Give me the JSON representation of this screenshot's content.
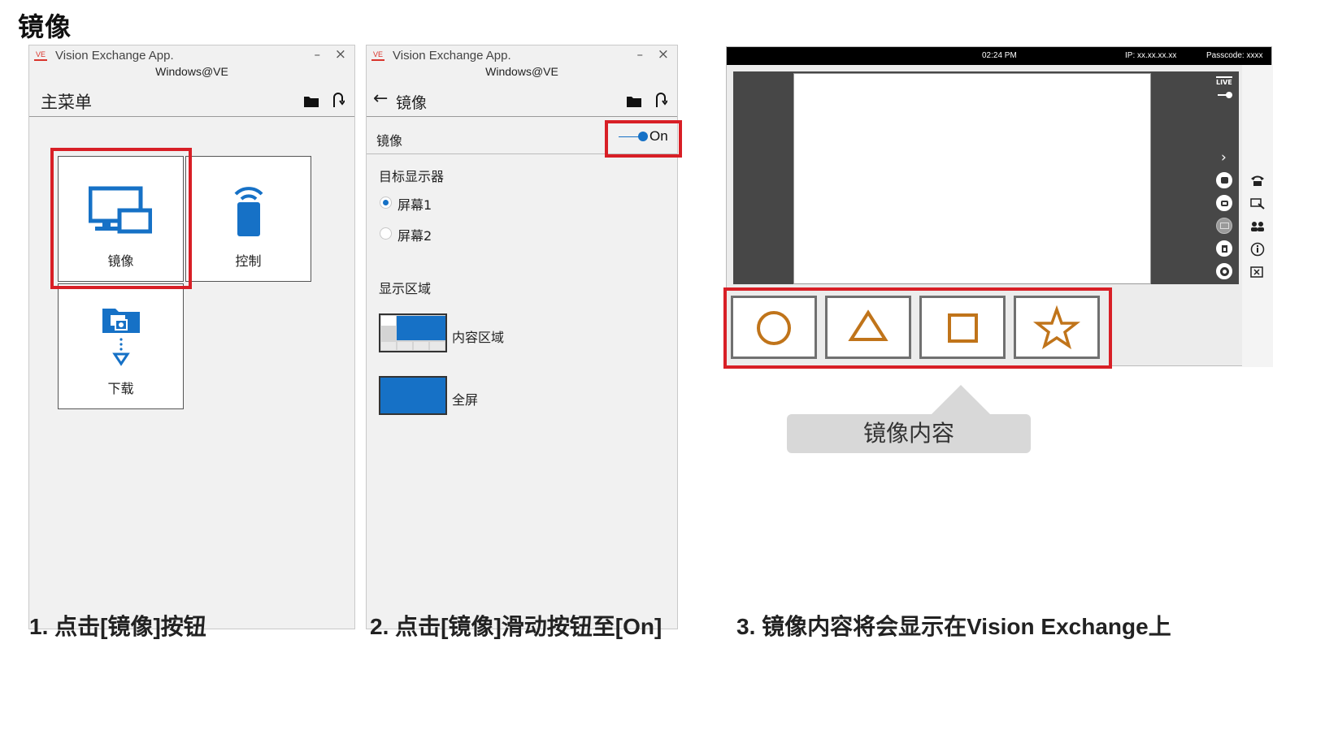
{
  "page": {
    "title": "镜像"
  },
  "window_common": {
    "app_title": "Vision Exchange App.",
    "subtitle": "Windows@VE",
    "logo_text": "VE",
    "minimize_glyph": "–",
    "close_glyph": "×"
  },
  "window1": {
    "header_title": "主菜单",
    "tiles": [
      {
        "label": "镜像",
        "icon": "mirror-monitor-icon"
      },
      {
        "label": "控制",
        "icon": "remote-control-icon"
      },
      {
        "label": "下载",
        "icon": "download-folder-icon"
      }
    ]
  },
  "window2": {
    "back_glyph": "←",
    "header_title": "镜像",
    "mirror_row_label": "镜像",
    "toggle_state": "On",
    "target_display_label": "目标显示器",
    "screens": [
      {
        "label": "屏幕1",
        "selected": true
      },
      {
        "label": "屏幕2",
        "selected": false
      }
    ],
    "display_area_label": "显示区域",
    "areas": [
      {
        "label": "内容区域"
      },
      {
        "label": "全屏"
      }
    ]
  },
  "display": {
    "time": "02:24 PM",
    "ip": "IP: xx.xx.xx.xx",
    "passcode": "Passcode: xxxx",
    "live_label": "LIVE",
    "shapes": [
      "circle",
      "triangle",
      "square",
      "star"
    ],
    "shape_color": "#c0741a",
    "callout": "镜像内容"
  },
  "accent_red": "#d81f26",
  "accent_blue": "#1671c6",
  "captions": {
    "step1": "1. 点击[镜像]按钮",
    "step2": "2. 点击[镜像]滑动按钮至[On]",
    "step3": "3. 镜像内容将会显示在Vision Exchange上"
  }
}
